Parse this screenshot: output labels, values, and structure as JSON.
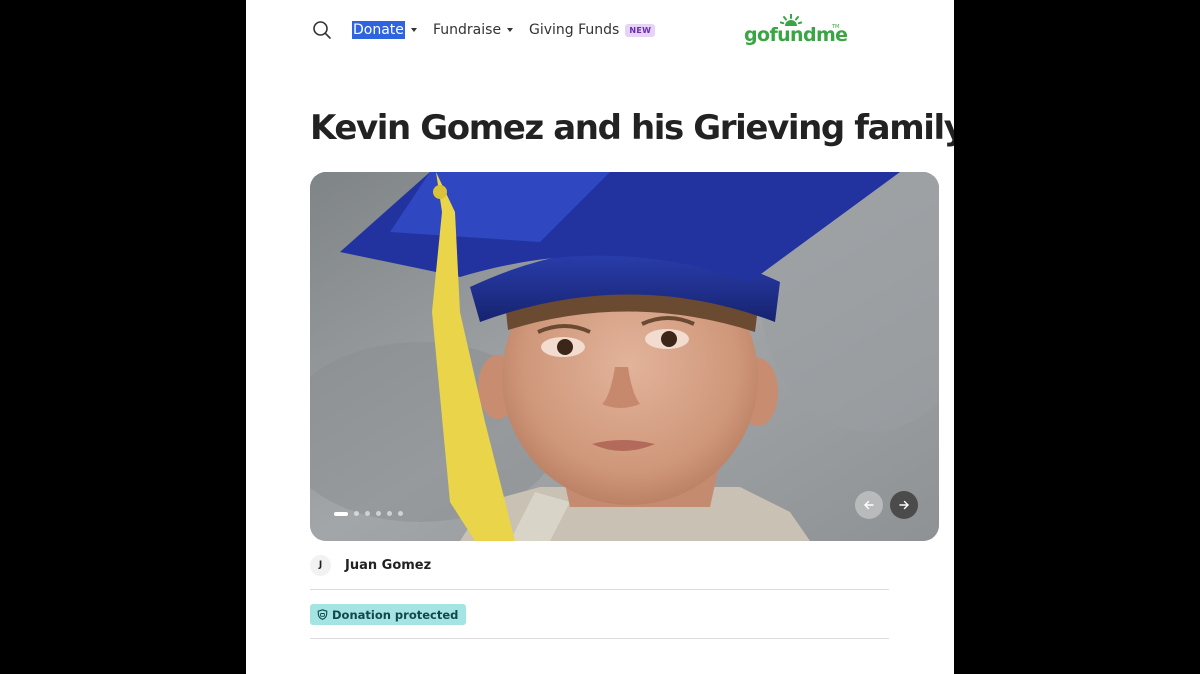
{
  "header": {
    "search_icon": "search-icon",
    "nav": {
      "donate": "Donate",
      "fundraise": "Fundraise",
      "giving_funds": "Giving Funds",
      "new_badge": "NEW"
    },
    "logo_text": "gofundme",
    "logo_tm": "TM",
    "brand_color": "#3aa544"
  },
  "campaign": {
    "title": "Kevin Gomez and his Grieving family",
    "carousel": {
      "slide_count": 6,
      "active_index": 0,
      "prev_icon": "arrow-left-icon",
      "next_icon": "arrow-right-icon"
    },
    "organizer": {
      "initial": "J",
      "name": "Juan Gomez"
    },
    "protection_badge": {
      "icon": "shield-icon",
      "label": "Donation protected",
      "color": "#a4e4e3"
    }
  }
}
